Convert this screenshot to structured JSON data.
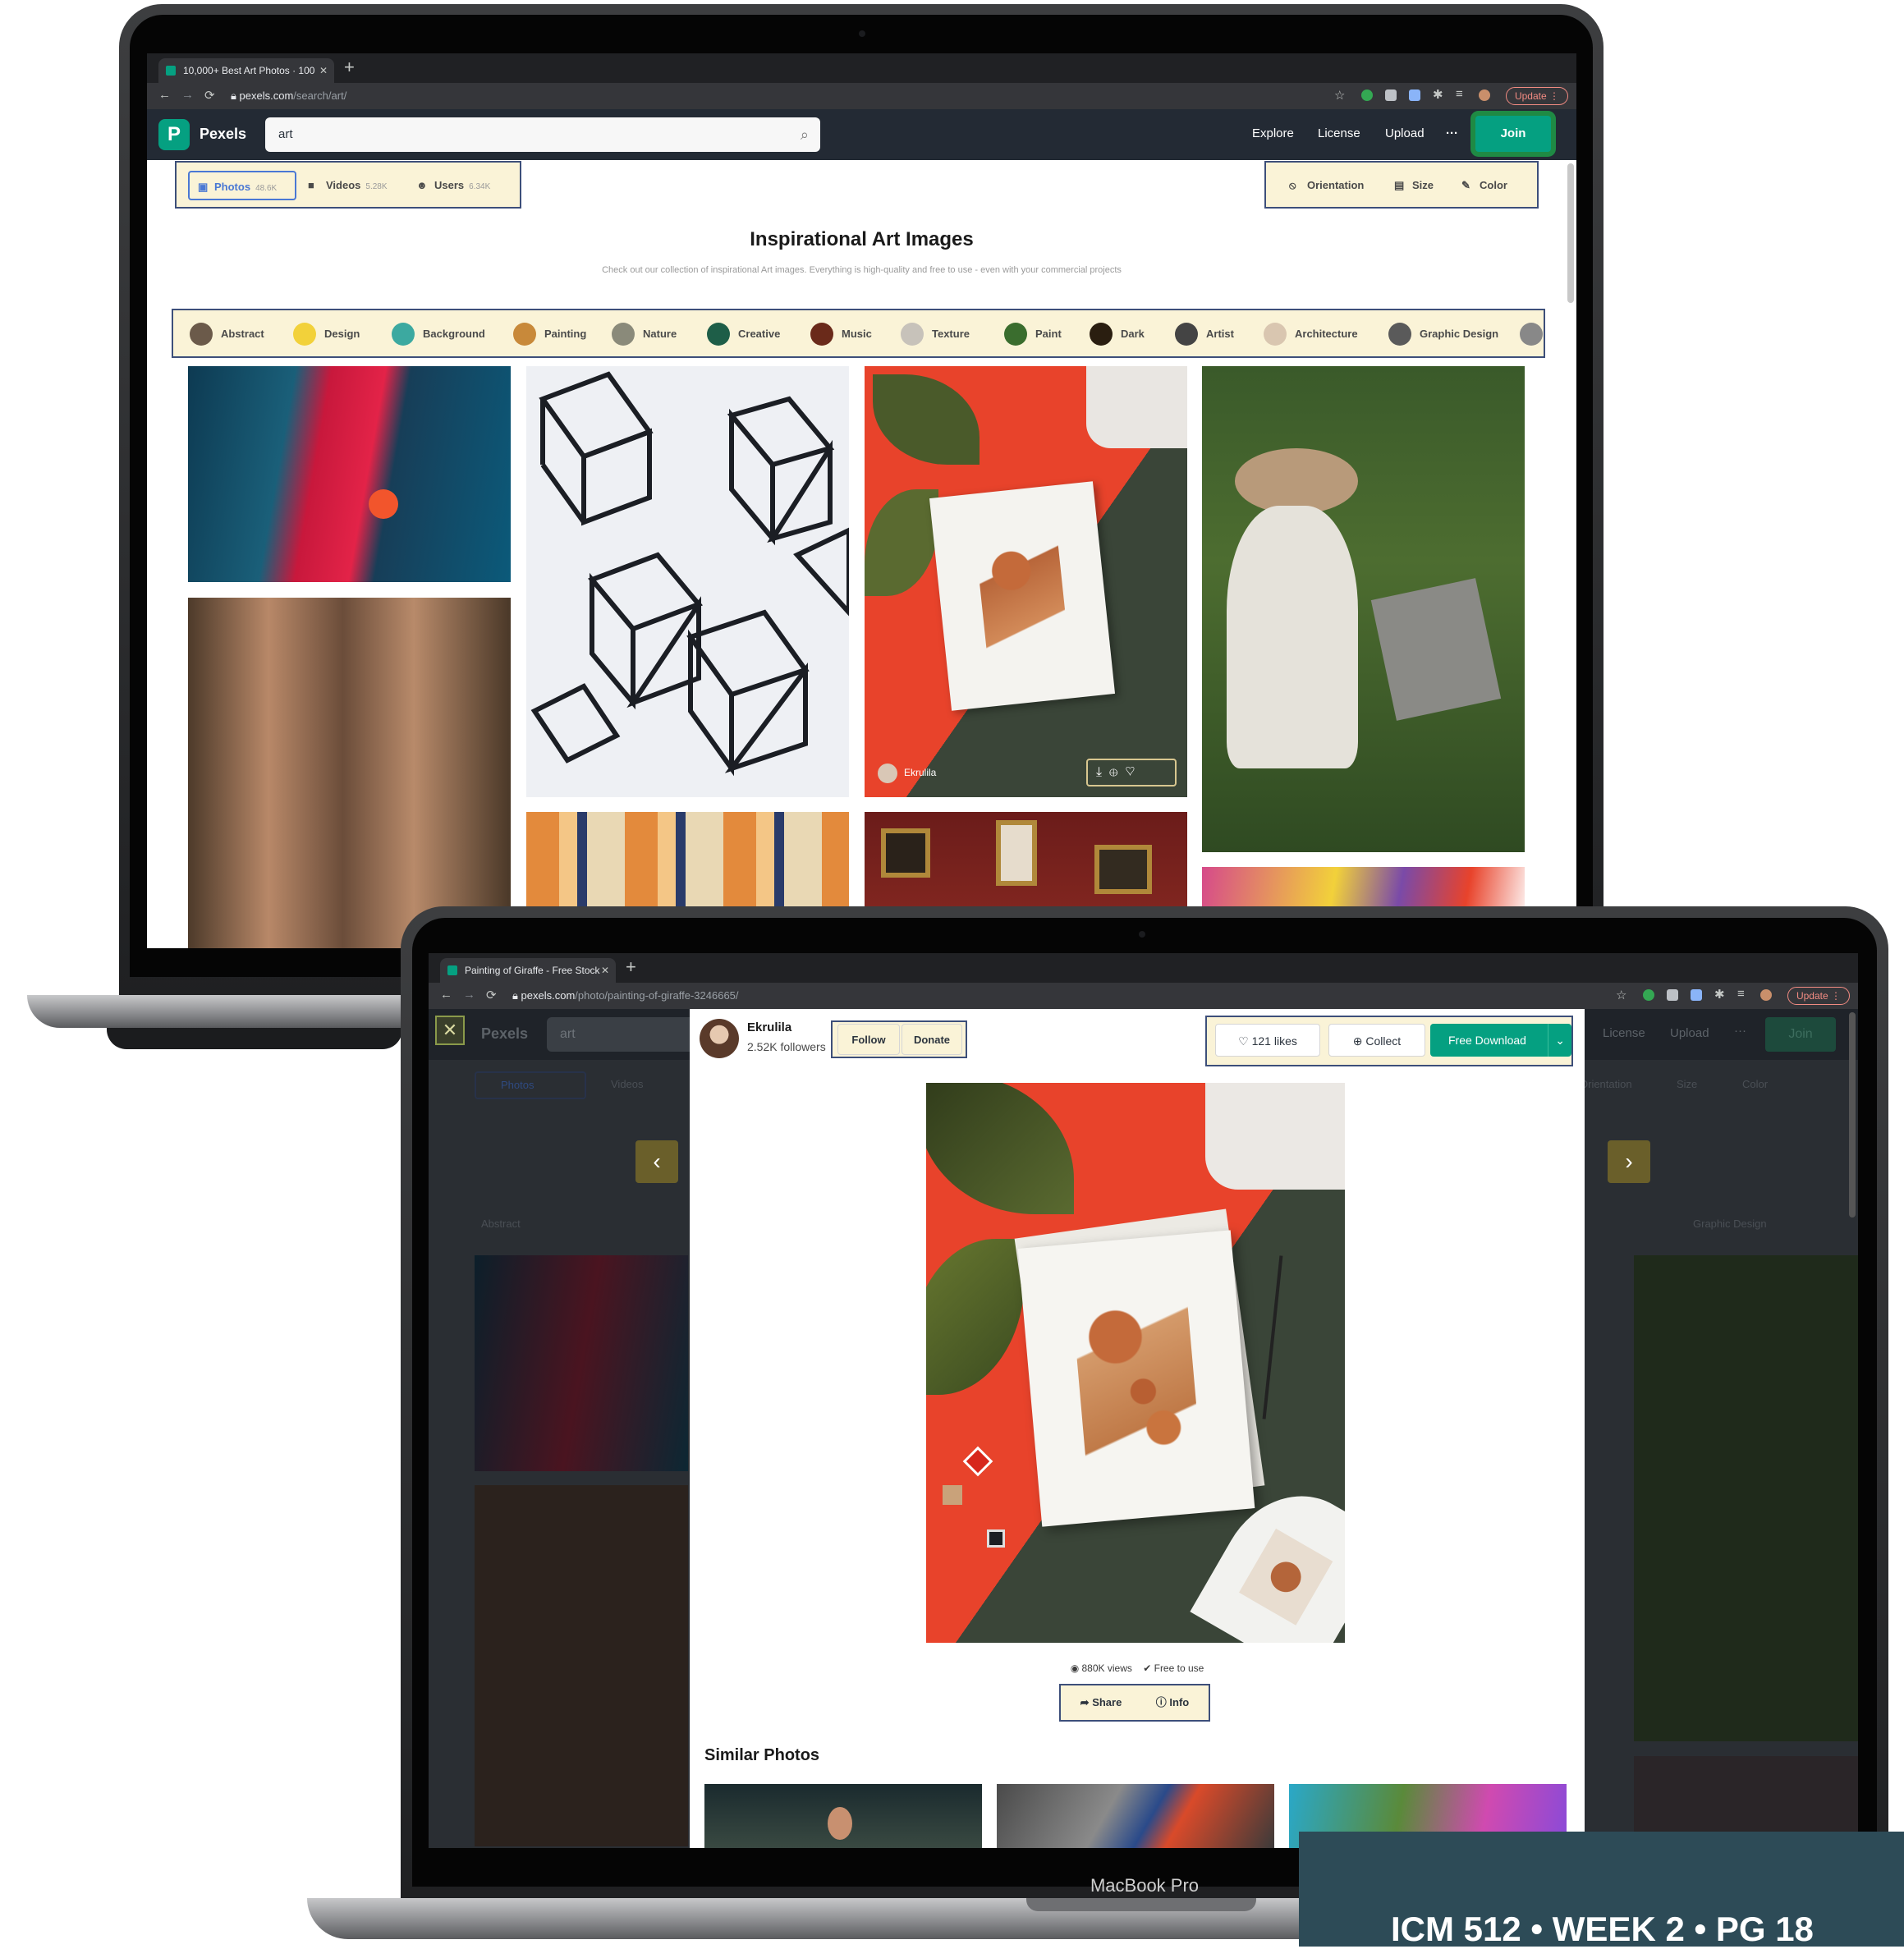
{
  "laptop1": {
    "tab_title": "10,000+ Best Art Photos · 100",
    "url_host": "pexels.com",
    "url_path": "/search/art/",
    "update_label": "Update",
    "brand": "Pexels",
    "search_value": "art",
    "nav": {
      "explore": "Explore",
      "license": "License",
      "upload": "Upload",
      "more": "···",
      "join": "Join"
    },
    "filters": {
      "photos": "Photos",
      "photos_count": "48.6K",
      "videos": "Videos",
      "videos_count": "5.28K",
      "users": "Users",
      "users_count": "6.34K",
      "orientation": "Orientation",
      "size": "Size",
      "color": "Color"
    },
    "heading": "Inspirational Art Images",
    "subheading": "Check out our collection of inspirational Art images. Everything is high-quality and free to use - even with your commercial projects",
    "categories": [
      "Abstract",
      "Design",
      "Background",
      "Painting",
      "Nature",
      "Creative",
      "Music",
      "Texture",
      "Paint",
      "Dark",
      "Artist",
      "Architecture",
      "Graphic Design"
    ],
    "photo_author": "Ekrulila"
  },
  "laptop2": {
    "tab_title": "Painting of Giraffe - Free Stock",
    "url_host": "pexels.com",
    "url_path": "/photo/painting-of-giraffe-3246665/",
    "update_label": "Update",
    "author": "Ekrulila",
    "followers": "2.52K followers",
    "follow": "Follow",
    "donate": "Donate",
    "likes": "121 likes",
    "collect": "Collect",
    "free_download": "Free Download",
    "views": "880K views",
    "free_to_use": "Free to use",
    "share": "Share",
    "info": "Info",
    "similar": "Similar Photos",
    "bg_brand": "Pexels",
    "bg_search": "art",
    "bg_nav": {
      "license": "License",
      "upload": "Upload",
      "join": "Join"
    },
    "bg_filters": {
      "photos": "Photos",
      "videos": "Videos",
      "orientation": "Orientation",
      "size": "Size",
      "color": "Color"
    },
    "bg_categories": {
      "abstract": "Abstract",
      "graphic_design": "Graphic Design"
    },
    "device_label": "MacBook Pro"
  },
  "footer": "ICM 512 • WEEK 2 • PG 18",
  "colors": {
    "pexels_green": "#05a081",
    "highlight": "#faf3d7",
    "outline": "#3d4f7a",
    "footer": "#2d4b57"
  }
}
